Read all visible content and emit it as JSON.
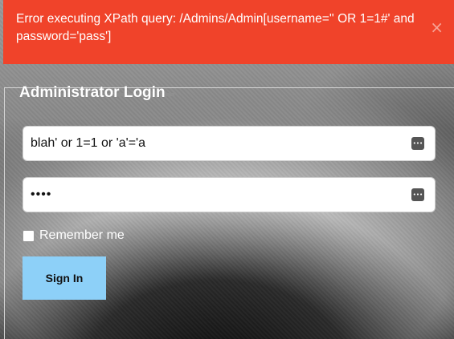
{
  "alert": {
    "message": "Error executing XPath query: /Admins/Admin[username='' OR 1=1#' and password='pass']",
    "close_label": "×"
  },
  "login": {
    "legend": "Administrator Login",
    "username_value": "blah' or 1=1 or 'a'='a",
    "password_value": "••••",
    "remember_label": "Remember me",
    "remember_checked": false,
    "signin_label": "Sign In"
  },
  "icons": {
    "username_field_icon": "password-manager-icon",
    "password_field_icon": "password-manager-icon"
  },
  "colors": {
    "alert_bg": "#f0432a",
    "button_bg": "#8dd0f8"
  }
}
